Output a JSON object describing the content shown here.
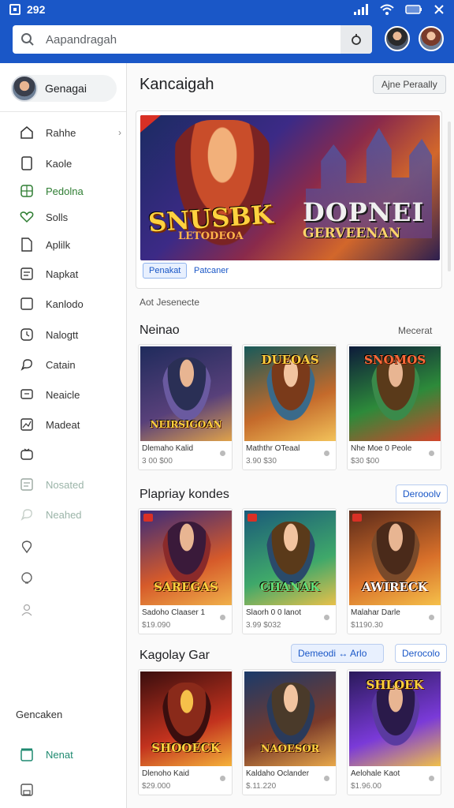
{
  "status_bar": {
    "time": "292"
  },
  "search": {
    "placeholder": "Aapandragah"
  },
  "sidebar": {
    "profile_name": "Genagai",
    "items": [
      {
        "label": "Rahhe",
        "icon": "home-icon"
      },
      {
        "label": "Kaole",
        "icon": "tablet-icon"
      },
      {
        "label": "Pedolna",
        "icon": "grid-icon"
      },
      {
        "label": "Solls",
        "icon": "heart-icon"
      },
      {
        "label": "Aplilk",
        "icon": "document-icon"
      },
      {
        "label": "Napkat",
        "icon": "list-icon"
      },
      {
        "label": "Kanlodo",
        "icon": "square-icon"
      },
      {
        "label": "Nalogtt",
        "icon": "clock-icon"
      },
      {
        "label": "Catain",
        "icon": "chat-icon"
      },
      {
        "label": "Neaicle",
        "icon": "message-icon"
      },
      {
        "label": "Madeat",
        "icon": "chart-icon"
      },
      {
        "label": "",
        "icon": "tv-icon"
      },
      {
        "label": "Nosated",
        "icon": "list-icon"
      },
      {
        "label": "Neahed",
        "icon": "chat-icon"
      },
      {
        "label": "",
        "icon": "pin-icon"
      },
      {
        "label": "",
        "icon": "bulb-icon"
      },
      {
        "label": "",
        "icon": "person-icon"
      }
    ],
    "footer_label": "Gencaken",
    "bottom_item": "Nenat"
  },
  "main": {
    "title": "Kancaigah",
    "top_pill": "Ajne  Peraally",
    "hero": {
      "title_left": "SNUSBK",
      "subtitle_left": "LETODEOA",
      "title_right": "DOPNEI",
      "subtitle_right": "GERVEENAN",
      "tag_active": "Penakat",
      "tag_other": "Patcaner"
    },
    "small_label": "Aot Jesenecte",
    "sections": [
      {
        "title": "Neinao",
        "link": "Mecerat",
        "cards": [
          {
            "name": "Dlemaho Kalid",
            "price": "3 00 $00",
            "caption": "NEIRSIGOAN",
            "colors": [
              "#1f2b5c",
              "#58407a",
              "#e0a24a"
            ]
          },
          {
            "name": "Maththr OTeaal",
            "price": "3.90 $30",
            "caption": "DUEOAS",
            "colors": [
              "#185a5a",
              "#c46a2b",
              "#f2c25a"
            ]
          },
          {
            "name": "Nhe Moe 0 Peole",
            "price": "$30 $00",
            "caption": "SNOMOS",
            "colors": [
              "#0d1a3a",
              "#2d8a3a",
              "#d2452b"
            ]
          }
        ]
      },
      {
        "title": "Plapriay kondes",
        "link": "Derooolv",
        "cards": [
          {
            "name": "Sadoho Claaser 1",
            "price": "$19.090",
            "caption": "SAREGAS",
            "colors": [
              "#3a2b7a",
              "#d65a2a",
              "#f0b04a"
            ]
          },
          {
            "name": "Slaorh 0 0 lanot",
            "price": "3.99 $032",
            "caption": "CHANAK",
            "colors": [
              "#1a5a7a",
              "#3fa86a",
              "#e8c04a"
            ]
          },
          {
            "name": "Malahar Darle",
            "price": "$1190.30",
            "caption": "AWIRECK",
            "colors": [
              "#5a2a1a",
              "#d8702a",
              "#f5c04a"
            ]
          }
        ]
      },
      {
        "title": "Kagolay Gar",
        "link": "Derocolo",
        "mid_button": "Demeodi  ↔  Arlo",
        "cards": [
          {
            "name": "Dlenoho Kaid",
            "price": "$29.000",
            "caption": "SHOOECK",
            "colors": [
              "#3a0e0e",
              "#c2321e",
              "#f5b23a"
            ]
          },
          {
            "name": "Kaldaho Oclander",
            "price": "$.11.220",
            "caption": "NAOESOR",
            "colors": [
              "#1a3a6a",
              "#7a3a2a",
              "#e8a84a"
            ]
          },
          {
            "name": "Aelohale Kaot",
            "price": "$1.96.00",
            "caption": "SHLOEK",
            "colors": [
              "#2a1a5a",
              "#7a3ad8",
              "#f0c04a"
            ]
          }
        ]
      }
    ]
  }
}
